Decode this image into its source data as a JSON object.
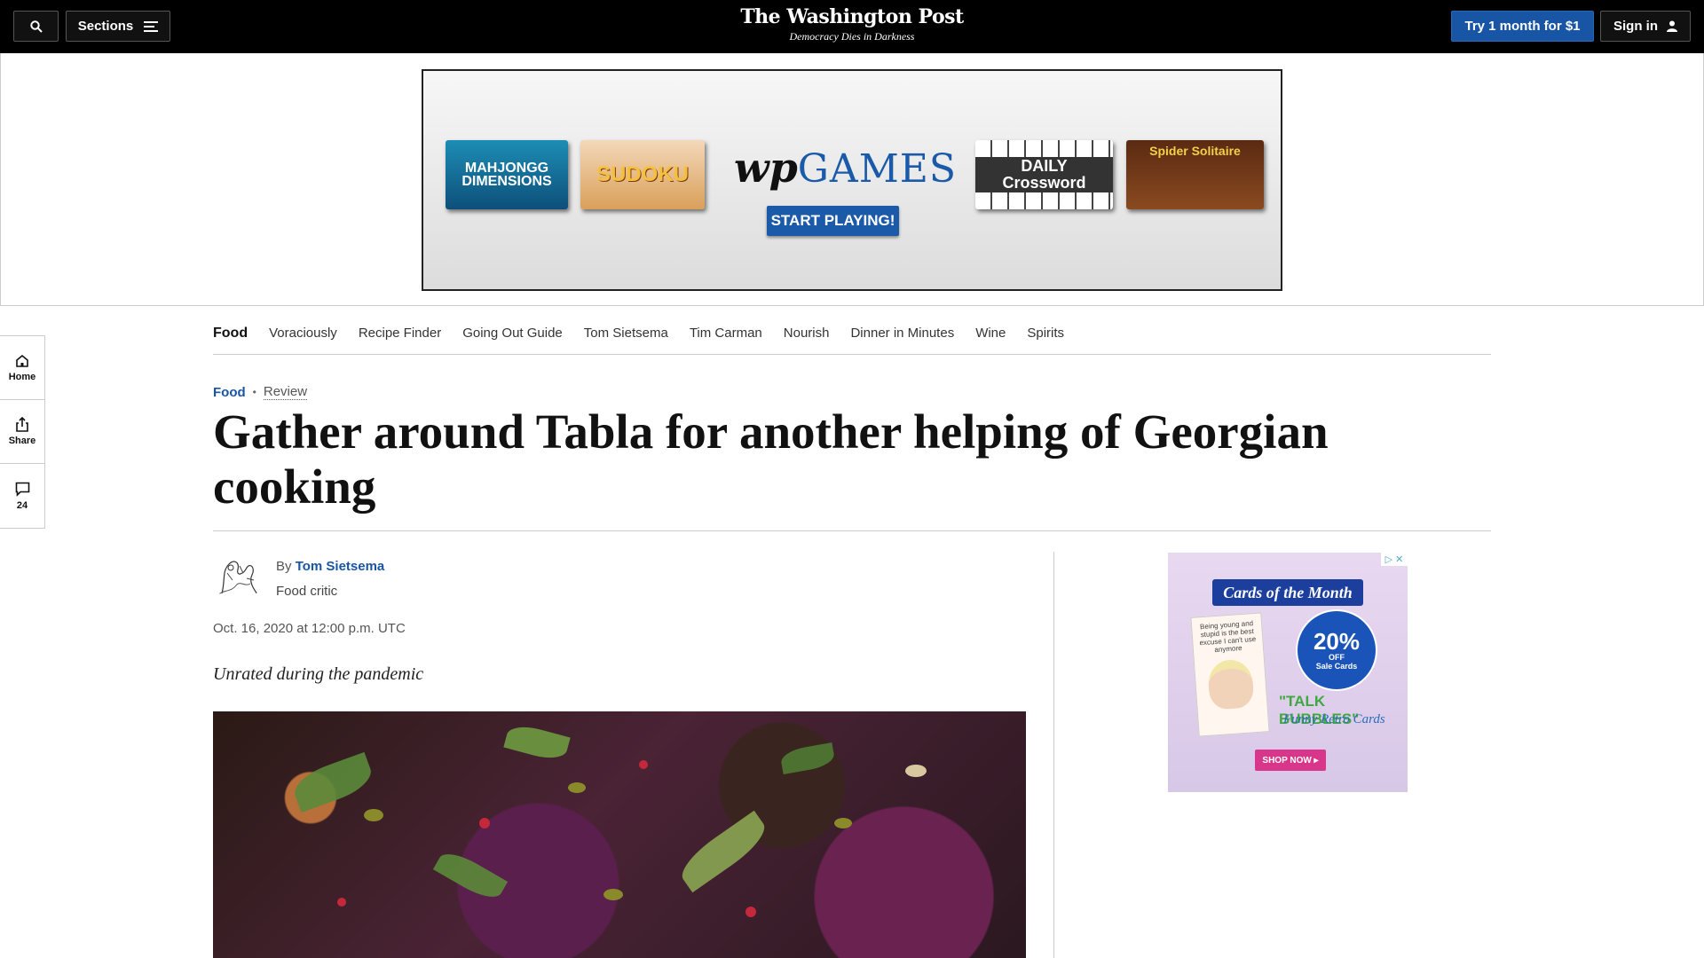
{
  "header": {
    "search_icon": "search-icon",
    "sections_label": "Sections",
    "brand": "The Washington Post",
    "tagline": "Democracy Dies in Darkness",
    "try_label": "Try 1 month for $1",
    "signin_label": "Sign in"
  },
  "top_ad": {
    "tiles": [
      "MAHJONGG DIMENSIONS",
      "SUDOKU",
      "DAILY Crossword",
      "Spider Solitaire"
    ],
    "logo_wp": "wp",
    "logo_games": "GAMES",
    "cta": "START PLAYING!"
  },
  "section_nav": {
    "current": "Food",
    "items": [
      "Voraciously",
      "Recipe Finder",
      "Going Out Guide",
      "Tom Sietsema",
      "Tim Carman",
      "Nourish",
      "Dinner in Minutes",
      "Wine",
      "Spirits"
    ]
  },
  "rail": {
    "home": "Home",
    "share": "Share",
    "comments_count": "24"
  },
  "article": {
    "section": "Food",
    "label": "Review",
    "headline": "Gather around Tabla for another helping of Georgian cooking",
    "by": "By",
    "author": "Tom Sietsema",
    "role": "Food critic",
    "timestamp": "Oct. 16, 2020 at 12:00 p.m. UTC",
    "subhead": "Unrated during the pandemic"
  },
  "side_ad": {
    "title": "Cards of the Month",
    "card_text": "Being young and stupid is the best excuse I can't use anymore",
    "discount": "20%",
    "off": "OFF",
    "sale": "Sale Cards",
    "talk": "\"TALK BUBBLES\"",
    "funny": "Funny Retro Cards",
    "shop": "SHOP NOW ▸"
  }
}
